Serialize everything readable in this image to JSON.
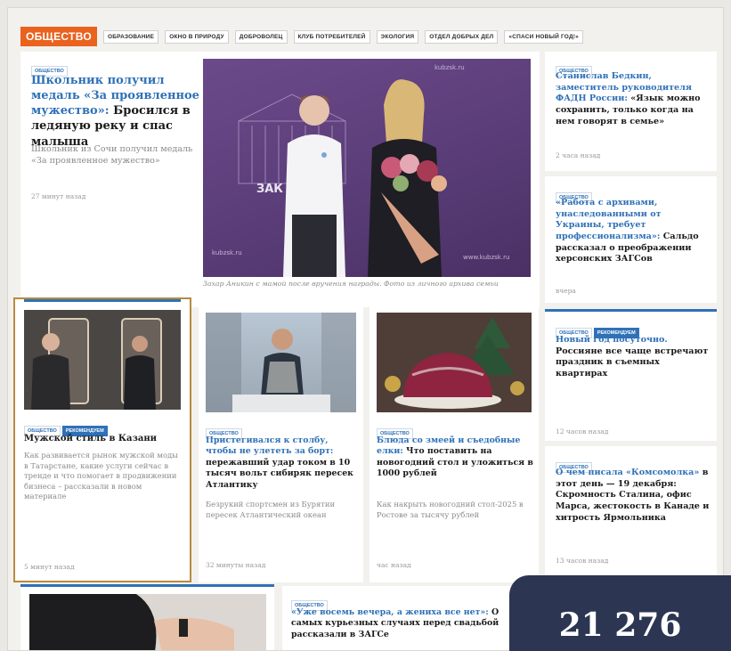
{
  "rubric": {
    "main": "ОБЩЕСТВО",
    "subs": [
      "ОБРАЗОВАНИЕ",
      "ОКНО В ПРИРОДУ",
      "ДОБРОВОЛЕЦ",
      "КЛУБ ПОТРЕБИТЕЛЕЙ",
      "ЭКОЛОГИЯ",
      "ОТДЕЛ ДОБРЫХ ДЕЛ",
      "«СПАСИ НОВЫЙ ГОД!»"
    ]
  },
  "featured": {
    "tag": "ОБЩЕСТВО",
    "headline_hl": "Школьник получил медаль «За проявленное мужество»:",
    "headline_rest": " Бросился в ледяную реку и спас малыша",
    "lead": "Школьник из Сочи получил медаль «За проявленное мужество»",
    "time": "27 минут назад",
    "photo_caption": "Захар Аникин с мамой после вручения награды. Фото из личного архива семьи",
    "photo_watermark_1": "kubzsk.ru",
    "photo_watermark_2": "www.kubzsk.ru",
    "photo_sign": "ЗАК"
  },
  "right": [
    {
      "tag": "ОБЩЕСТВО",
      "hl": "Станислав Бедкин, заместитель руководителя ФАДН России:",
      "rest": " «Язык можно сохранить, только когда на нем говорят в семье»",
      "time": "2 часа назад"
    },
    {
      "tag": "ОБЩЕСТВО",
      "hl": "«Работа с архивами, унаследованными от Украины, требует профессионализма»:",
      "rest": " Сальдо рассказал о преображении херсонских ЗАГСов",
      "time": "вчера"
    },
    {
      "tag": "ОБЩЕСТВО",
      "tag2": "РЕКОМЕНДУЕМ",
      "hl": "Новый год посуточно.",
      "rest": " Россияне все чаще встречают праздник в съемных квартирах",
      "time": "12 часов назад"
    },
    {
      "tag": "ОБЩЕСТВО",
      "hl": "О чем писала «Комсомолка»",
      "rest": " в этот день — 19 декабря: Скромность Сталина, офис Марса, жестокость в Канаде и хитрость Ярмольника",
      "time": "13 часов назад"
    }
  ],
  "row2": [
    {
      "tag": "ОБЩЕСТВО",
      "tag2": "РЕКОМЕНДУЕМ",
      "hl": "",
      "rest": "Мужской стиль в Казани",
      "lead": "Как развивается рынок мужской моды в Татарстане, какие услуги сейчас в тренде и что помогает в продвижении бизнеса – рассказали в новом материале",
      "time": "5 минут назад"
    },
    {
      "tag": "ОБЩЕСТВО",
      "hl": "Пристегивался к столбу, чтобы не улететь за борт:",
      "rest": " пережавший удар током в 10 тысяч вольт сибиряк пересек Атлантику",
      "lead": "Безрукий спортсмен из Бурятии пересек Атлантический океан",
      "time": "32 минуты назад"
    },
    {
      "tag": "ОБЩЕСТВО",
      "hl": "Блюда со змеей и съедобные елки:",
      "rest": " Что поставить на новогодний стол и уложиться в 1000 рублей",
      "lead": "Как накрыть новогодний стол-2025 в Ростове за тысячу рублей",
      "time": "час назад"
    }
  ],
  "bottom": {
    "tag": "ОБЩЕСТВО",
    "hl": "«Уже восемь вечера, а жениха все нет»:",
    "rest": " О самых курьезных случаях перед свадьбой рассказали в ЗАГСе"
  },
  "counter": "21 276",
  "colors": {
    "accent": "#2f71b7",
    "rubric": "#e9621e",
    "counter_bg": "#2c3653",
    "highlight_border": "#b98a3e"
  }
}
